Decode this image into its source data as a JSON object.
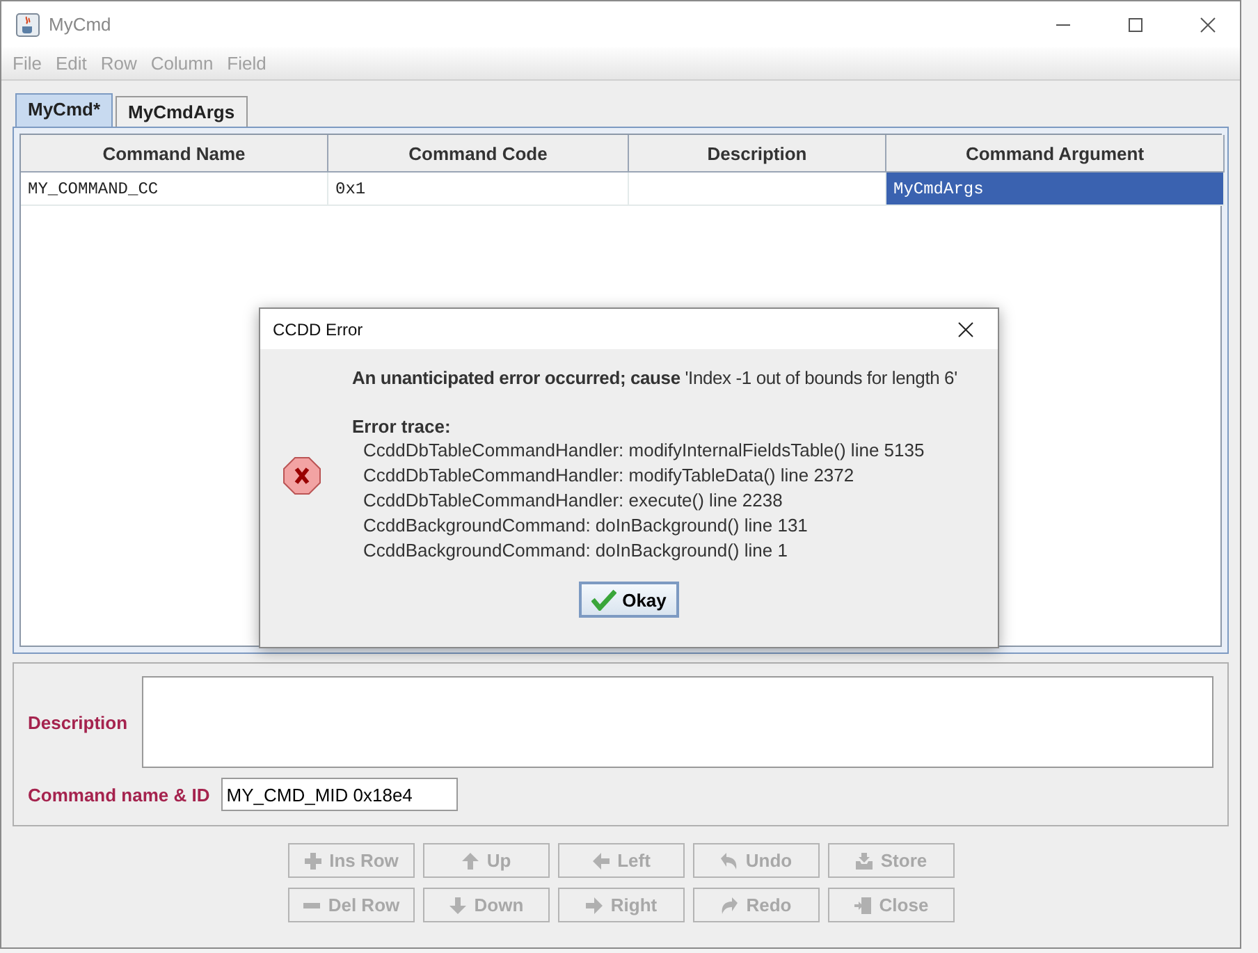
{
  "window": {
    "title": "MyCmd"
  },
  "menu": [
    "File",
    "Edit",
    "Row",
    "Column",
    "Field"
  ],
  "tabs": [
    {
      "label": "MyCmd*",
      "selected": true
    },
    {
      "label": "MyCmdArgs",
      "selected": false
    }
  ],
  "table": {
    "columns": [
      "Command Name",
      "Command Code",
      "Description",
      "Command Argument"
    ],
    "rows": [
      {
        "cells": [
          {
            "text": "MY_COMMAND_CC",
            "selected": false
          },
          {
            "text": "0x1",
            "selected": false
          },
          {
            "selected": false
          },
          {
            "text": "MyCmdArgs",
            "selected": true
          }
        ]
      }
    ]
  },
  "fields": [
    {
      "kind": "area",
      "label": "Description"
    },
    {
      "kind": "line",
      "label": "Command name & ID",
      "value": "MY_CMD_MID 0x18e4"
    }
  ],
  "buttons": [
    [
      {
        "label": "Ins Row",
        "kind": "plus",
        "disabled": true
      },
      {
        "label": "Up",
        "kind": "up",
        "disabled": true
      },
      {
        "label": "Left",
        "kind": "left",
        "disabled": true
      },
      {
        "label": "Undo",
        "kind": "undo",
        "disabled": true
      },
      {
        "label": "Store",
        "kind": "store",
        "disabled": true
      }
    ],
    [
      {
        "label": "Del Row",
        "kind": "minus",
        "disabled": true
      },
      {
        "label": "Down",
        "kind": "down",
        "disabled": true
      },
      {
        "label": "Right",
        "kind": "right",
        "disabled": true
      },
      {
        "label": "Redo",
        "kind": "redo",
        "disabled": true
      },
      {
        "label": "Close",
        "kind": "close",
        "disabled": true
      }
    ]
  ],
  "dialog": {
    "title": "CCDD Error",
    "message": "**An unanticipated error occurred; cause** 'Index -1 out of bounds for length 6'",
    "trace_heading": "Error trace:",
    "trace": [
      "CcddDbTableCommandHandler: modifyInternalFieldsTable() line 5135",
      "CcddDbTableCommandHandler: modifyTableData() line 2372",
      "CcddDbTableCommandHandler: execute() line 2238",
      "CcddBackgroundCommand: doInBackground() line 131",
      "CcddBackgroundCommand: doInBackground() line 1"
    ],
    "button": "Okay"
  }
}
